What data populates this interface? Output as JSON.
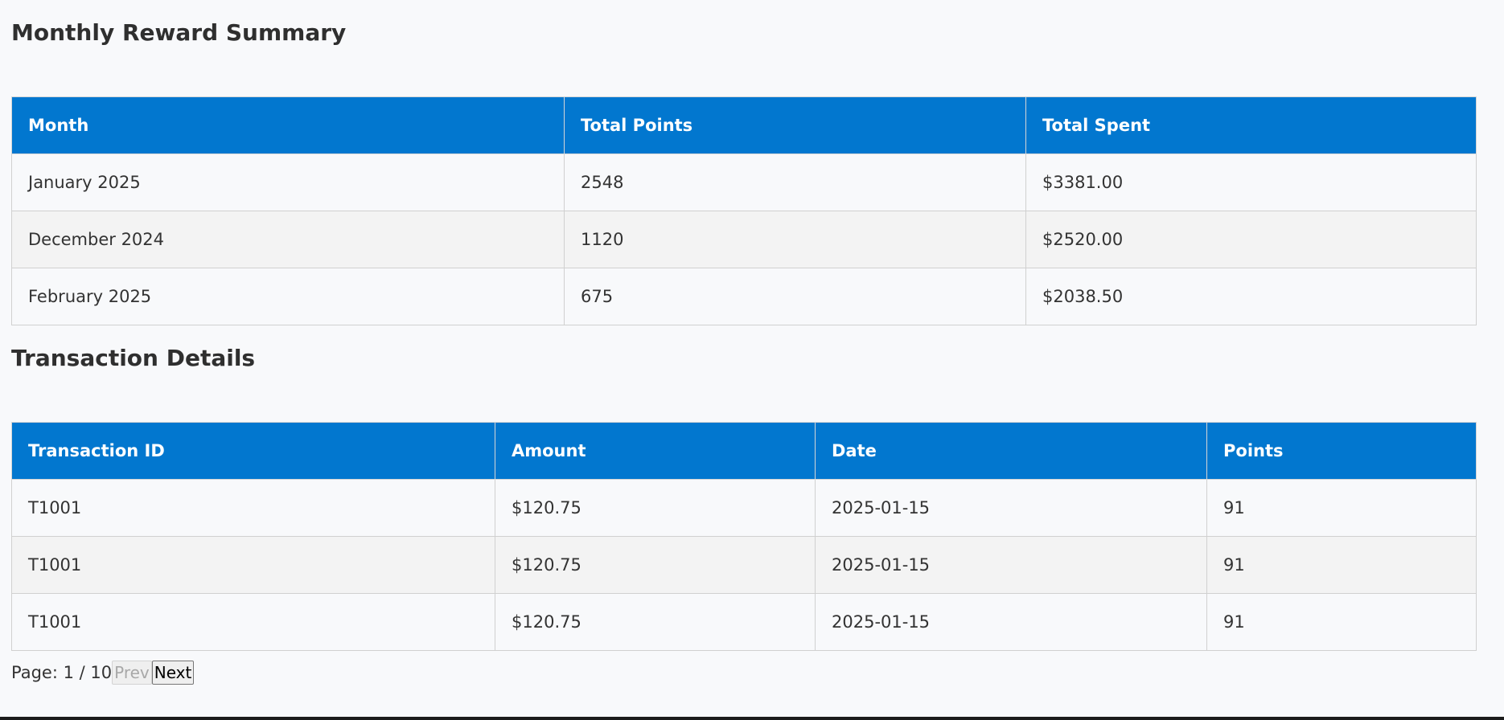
{
  "summary": {
    "title": "Monthly Reward Summary",
    "columns": [
      "Month",
      "Total Points",
      "Total Spent"
    ],
    "rows": [
      [
        "January 2025",
        "2548",
        "$3381.00"
      ],
      [
        "December 2024",
        "1120",
        "$2520.00"
      ],
      [
        "February 2025",
        "675",
        "$2038.50"
      ]
    ]
  },
  "details": {
    "title": "Transaction Details",
    "columns": [
      "Transaction ID",
      "Amount",
      "Date",
      "Points"
    ],
    "rows": [
      [
        "T1001",
        "$120.75",
        "2025-01-15",
        "91"
      ],
      [
        "T1001",
        "$120.75",
        "2025-01-15",
        "91"
      ],
      [
        "T1001",
        "$120.75",
        "2025-01-15",
        "91"
      ]
    ]
  },
  "pagination": {
    "label": "Page: 1 / 10",
    "prev_label": "Prev",
    "next_label": "Next",
    "prev_disabled": true
  },
  "colors": {
    "header_bg": "#0277cf",
    "header_text": "#ffffff"
  }
}
